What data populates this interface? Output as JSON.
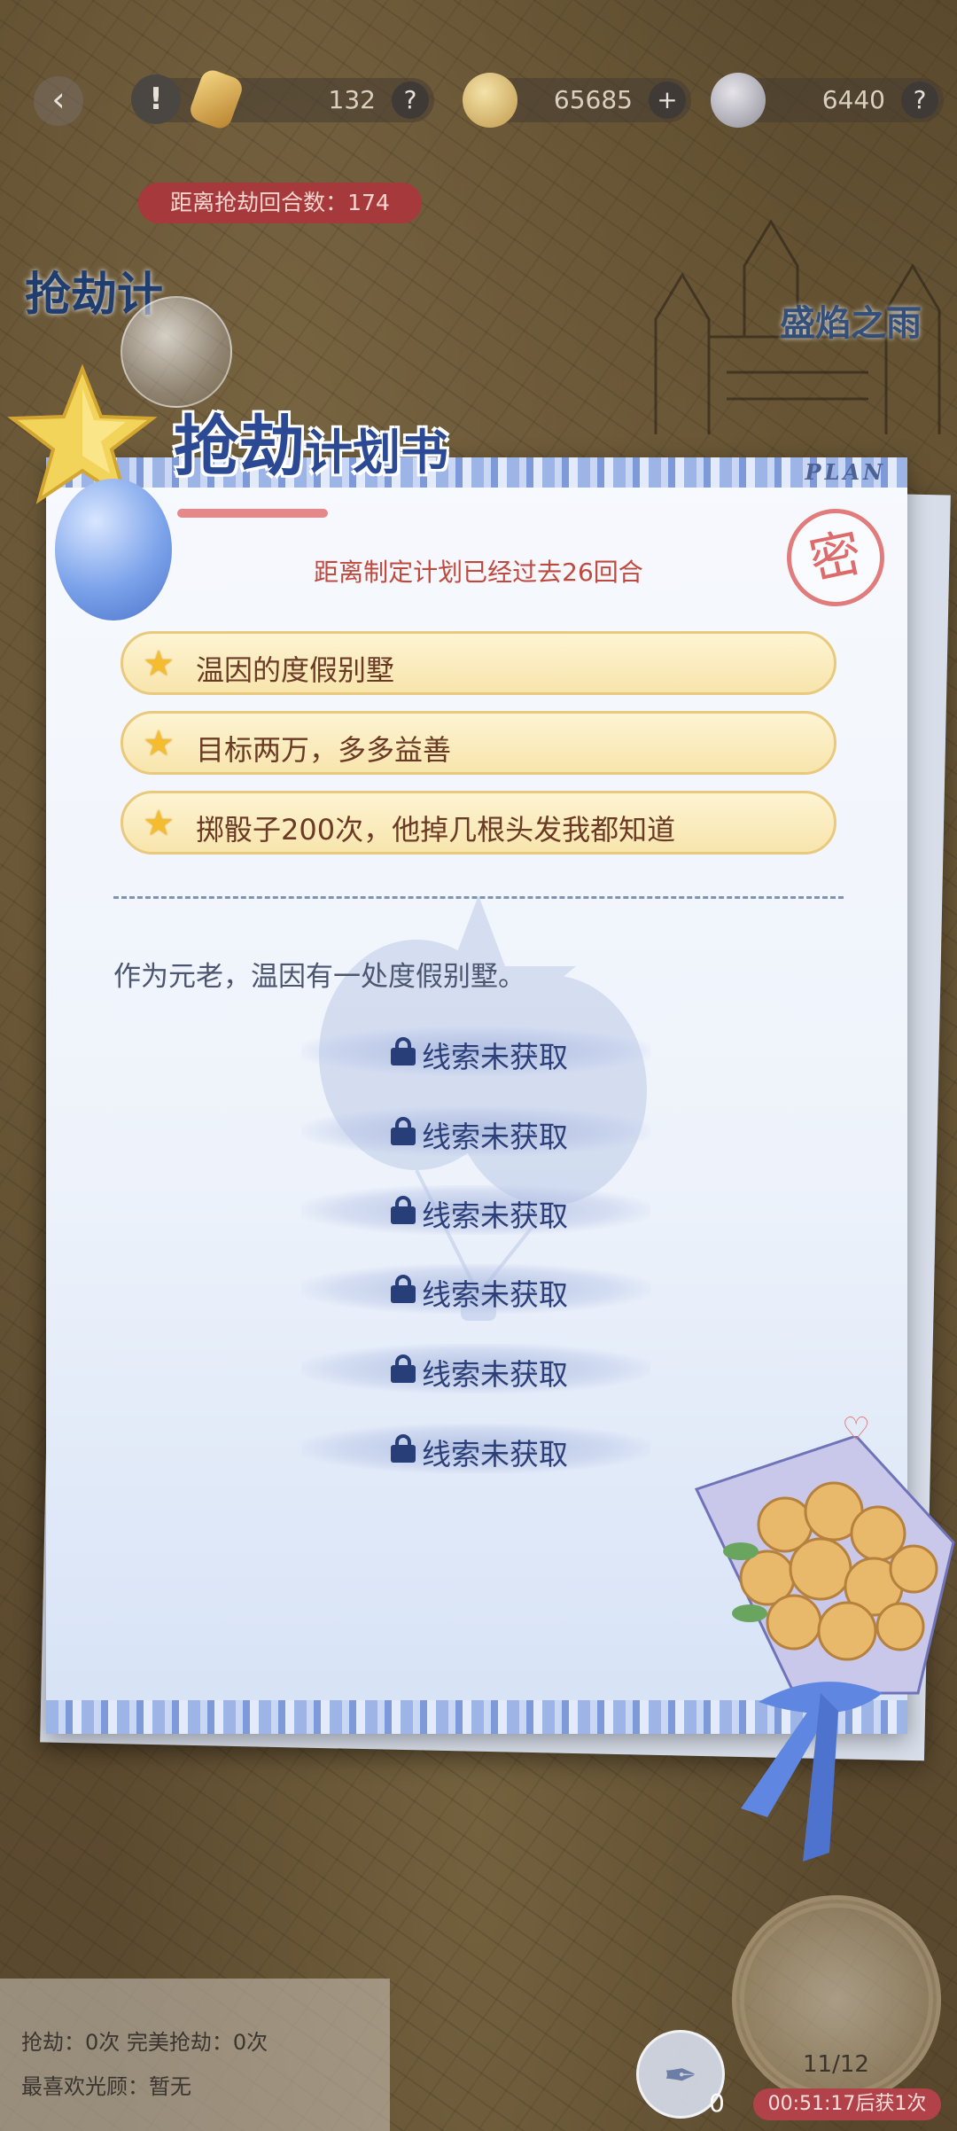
{
  "resources": {
    "item_count": "132",
    "coins": "65685",
    "gems": "6440",
    "help_label": "?",
    "add_label": "+"
  },
  "background": {
    "countdown_text": "距离抢劫回合数：174",
    "left_title": "抢劫计",
    "right_title": "盛焰之雨"
  },
  "card": {
    "title_big1": "抢",
    "title_big2": "劫",
    "title_small": "计划书",
    "plan_tag": "PLAN",
    "stamp": "密",
    "elapsed_text": "距离制定计划已经过去26回合",
    "goals": [
      "温因的度假别墅",
      "目标两万，多多益善",
      "掷骰子200次，他掉几根头发我都知道"
    ],
    "description": "作为元老，温因有一处度假别墅。",
    "clue_locked_label": "线索未获取"
  },
  "bottom": {
    "robbery_stats": "抢劫：0次  完美抢劫：0次",
    "favorite_patron": "最喜欢光顾：暂无",
    "feather_count": "0",
    "dice_progress": "11/12",
    "timer_text": "00:51:17后获1次"
  },
  "colors": {
    "title_blue": "#2b4a93",
    "stamp_red": "#de6b6b",
    "goal_bg": "#f8e5ad",
    "countdown_red": "#a5393c"
  }
}
